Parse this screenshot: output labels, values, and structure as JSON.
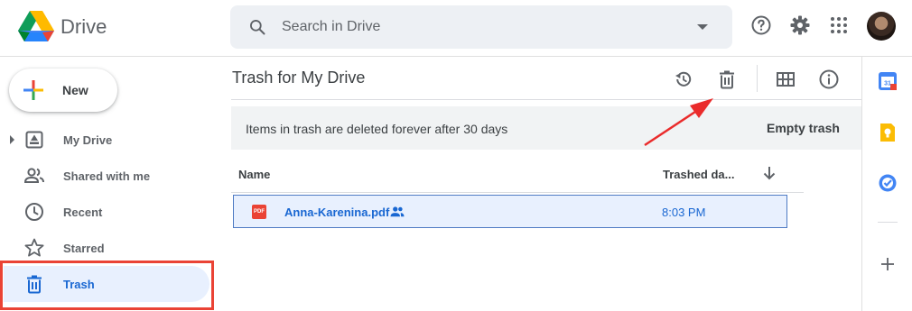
{
  "app": {
    "brand": "Drive",
    "search_placeholder": "Search in Drive",
    "icons": [
      "drive-logo",
      "search-icon",
      "help-icon",
      "settings-icon",
      "apps-icon",
      "avatar"
    ]
  },
  "sidebar": {
    "new_label": "New",
    "items": [
      {
        "label": "My Drive",
        "icon": "my-drive-icon",
        "active": false
      },
      {
        "label": "Shared with me",
        "icon": "shared-icon",
        "active": false
      },
      {
        "label": "Recent",
        "icon": "clock-icon",
        "active": false
      },
      {
        "label": "Starred",
        "icon": "star-icon",
        "active": false
      },
      {
        "label": "Trash",
        "icon": "trash-icon",
        "active": true
      }
    ]
  },
  "main": {
    "title": "Trash for My Drive",
    "banner_message": "Items in trash are deleted forever after 30 days",
    "empty_trash_label": "Empty trash",
    "columns": {
      "name": "Name",
      "trashed": "Trashed da..."
    },
    "files": [
      {
        "name": "Anna-Karenina.pdf",
        "type_badge": "PDF",
        "trashed": "8:03 PM",
        "shared": true
      }
    ]
  },
  "colors": {
    "accent": "#1967d2",
    "active_bg": "#e8f0fe",
    "highlight_red": "#ea4335",
    "search_bg": "#edf0f4",
    "banner_bg": "#f1f3f4"
  }
}
